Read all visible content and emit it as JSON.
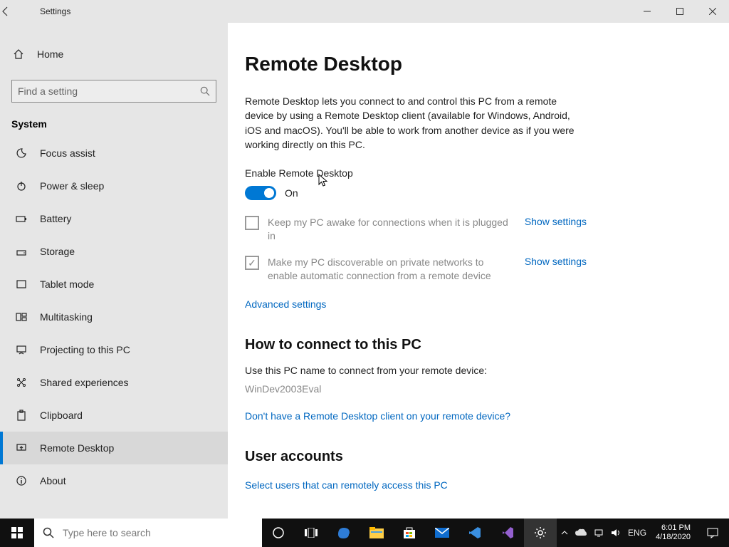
{
  "window": {
    "title": "Settings"
  },
  "sidebar": {
    "home": "Home",
    "search_placeholder": "Find a setting",
    "group": "System",
    "items": [
      {
        "label": "Focus assist"
      },
      {
        "label": "Power & sleep"
      },
      {
        "label": "Battery"
      },
      {
        "label": "Storage"
      },
      {
        "label": "Tablet mode"
      },
      {
        "label": "Multitasking"
      },
      {
        "label": "Projecting to this PC"
      },
      {
        "label": "Shared experiences"
      },
      {
        "label": "Clipboard"
      },
      {
        "label": "Remote Desktop"
      },
      {
        "label": "About"
      }
    ]
  },
  "main": {
    "title": "Remote Desktop",
    "description": "Remote Desktop lets you connect to and control this PC from a remote device by using a Remote Desktop client (available for Windows, Android, iOS and macOS). You'll be able to work from another device as if you were working directly on this PC.",
    "enable_label": "Enable Remote Desktop",
    "toggle_state": "On",
    "check1": "Keep my PC awake for connections when it is plugged in",
    "check2": "Make my PC discoverable on private networks to enable automatic connection from a remote device",
    "show_settings": "Show settings",
    "advanced": "Advanced settings",
    "howto_header": "How to connect to this PC",
    "howto_text": "Use this PC name to connect from your remote device:",
    "pc_name": "WinDev2003Eval",
    "no_client_link": "Don't have a Remote Desktop client on your remote device?",
    "user_accounts_header": "User accounts",
    "select_users_link": "Select users that can remotely access this PC"
  },
  "taskbar": {
    "search_placeholder": "Type here to search",
    "lang": "ENG",
    "time": "6:01 PM",
    "date": "4/18/2020"
  }
}
